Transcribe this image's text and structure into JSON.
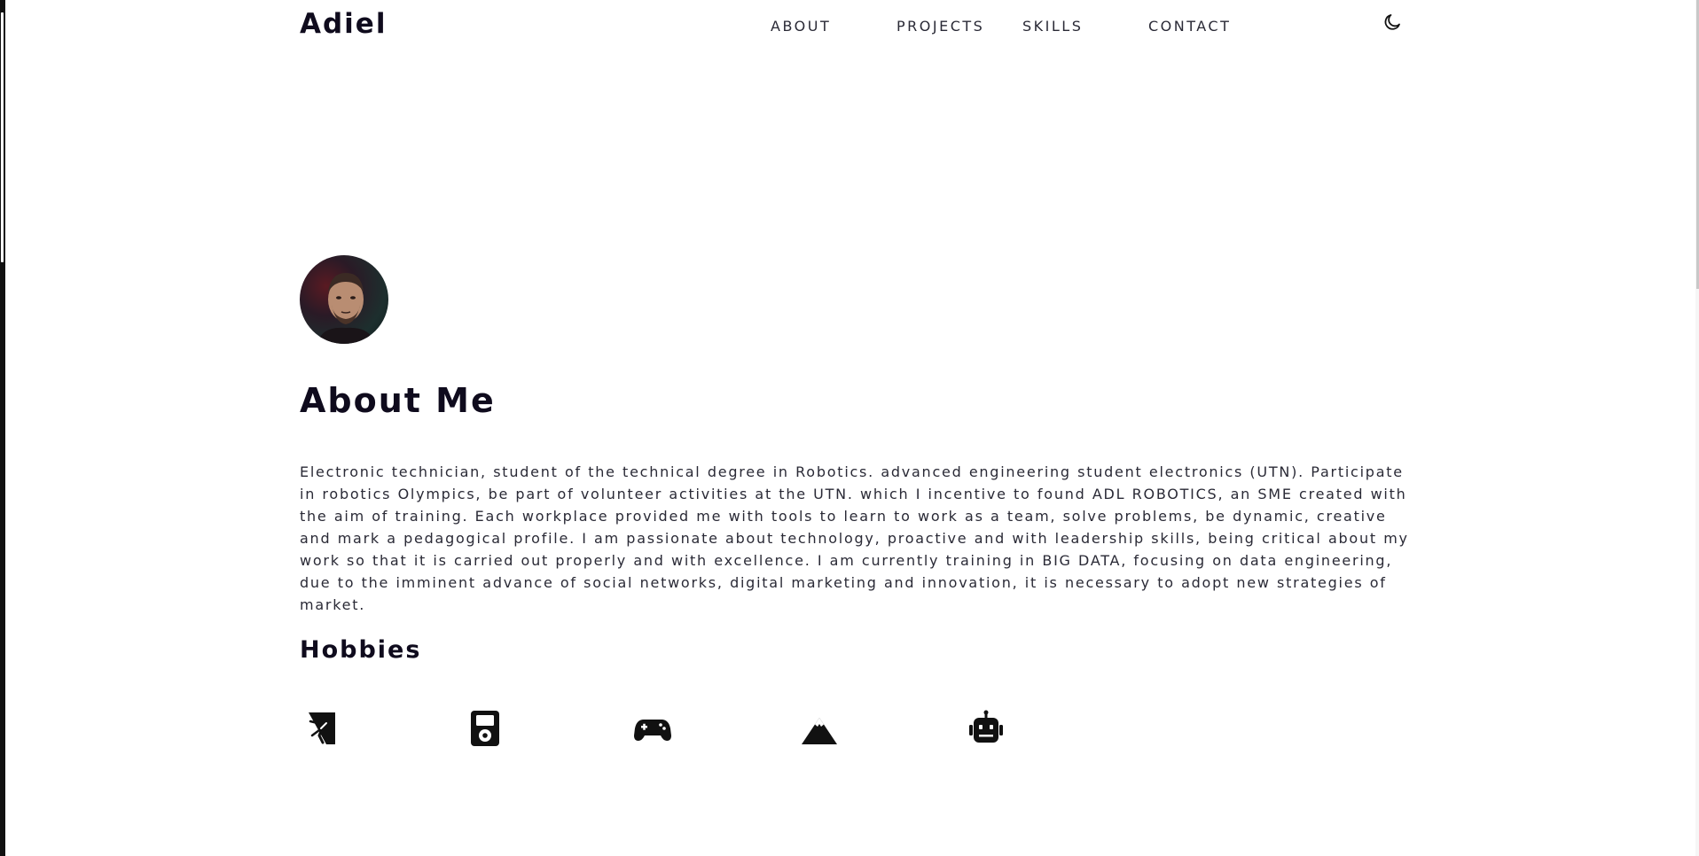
{
  "logo": "Adiel",
  "nav": {
    "items": [
      {
        "label": "ABOUT"
      },
      {
        "label": "PROJECTS"
      },
      {
        "label": "SKILLS"
      },
      {
        "label": "CONTACT"
      }
    ],
    "theme_icon": "moon-icon"
  },
  "about": {
    "title": "About Me",
    "avatar_icon": "profile-photo",
    "text": "Electronic technician, student of the technical degree in Robotics. advanced engineering student electronics (UTN). Participate in robotics Olympics, be part of volunteer activities at the UTN. which I incentive to found ADL ROBOTICS, an SME created with the aim of training. Each workplace provided me with tools to learn to work as a team, solve problems, be dynamic, creative and mark a pedagogical profile. I am passionate about technology, proactive and with leadership skills, being critical about my work so that it is carried out properly and with excellence. I am currently training in BIG DATA, focusing on data engineering, due to the imminent advance of social networks, digital marketing and innovation, it is necessary to adopt new strategies of market."
  },
  "hobbies": {
    "title": "Hobbies",
    "icons": [
      "climbing-icon",
      "music-player-icon",
      "gamepad-icon",
      "mountain-icon",
      "robot-icon"
    ]
  },
  "colors": {
    "text_dark": "#0f0b1d",
    "text_body": "#2a2a36",
    "background": "#ffffff"
  }
}
